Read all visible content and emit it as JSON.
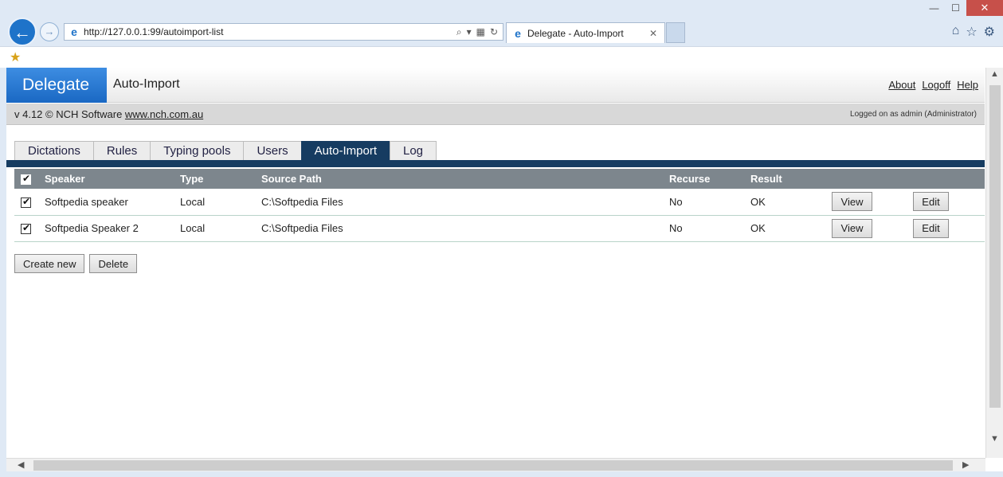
{
  "browser": {
    "url": "http://127.0.0.1:99/autoimport-list",
    "tab_title": "Delegate - Auto-Import",
    "window_controls": [
      "—",
      "☐",
      "✕"
    ]
  },
  "app": {
    "logo": "Delegate",
    "title": "Auto-Import",
    "links": [
      "About",
      "Logoff",
      "Help"
    ],
    "version_text": "v 4.12 © NCH Software ",
    "version_link": "www.nch.com.au",
    "logged_on": "Logged on as admin (Administrator)"
  },
  "tabs": [
    {
      "label": "Dictations",
      "active": false
    },
    {
      "label": "Rules",
      "active": false
    },
    {
      "label": "Typing pools",
      "active": false
    },
    {
      "label": "Users",
      "active": false
    },
    {
      "label": "Auto-Import",
      "active": true
    },
    {
      "label": "Log",
      "active": false
    }
  ],
  "table": {
    "columns": [
      "Speaker",
      "Type",
      "Source Path",
      "Recurse",
      "Result"
    ],
    "rows": [
      {
        "checked": true,
        "speaker": "Softpedia speaker",
        "type": "Local",
        "source_path": "C:\\Softpedia Files",
        "recurse": "No",
        "result": "OK",
        "view": "View",
        "edit": "Edit"
      },
      {
        "checked": true,
        "speaker": "Softpedia Speaker 2",
        "type": "Local",
        "source_path": "C:\\Softpedia Files",
        "recurse": "No",
        "result": "OK",
        "view": "View",
        "edit": "Edit"
      }
    ]
  },
  "actions": {
    "create_new": "Create new",
    "delete": "Delete"
  },
  "colors": {
    "accent": "#163c61",
    "logo_blue": "#1a68c3",
    "table_header": "#7d868d"
  }
}
